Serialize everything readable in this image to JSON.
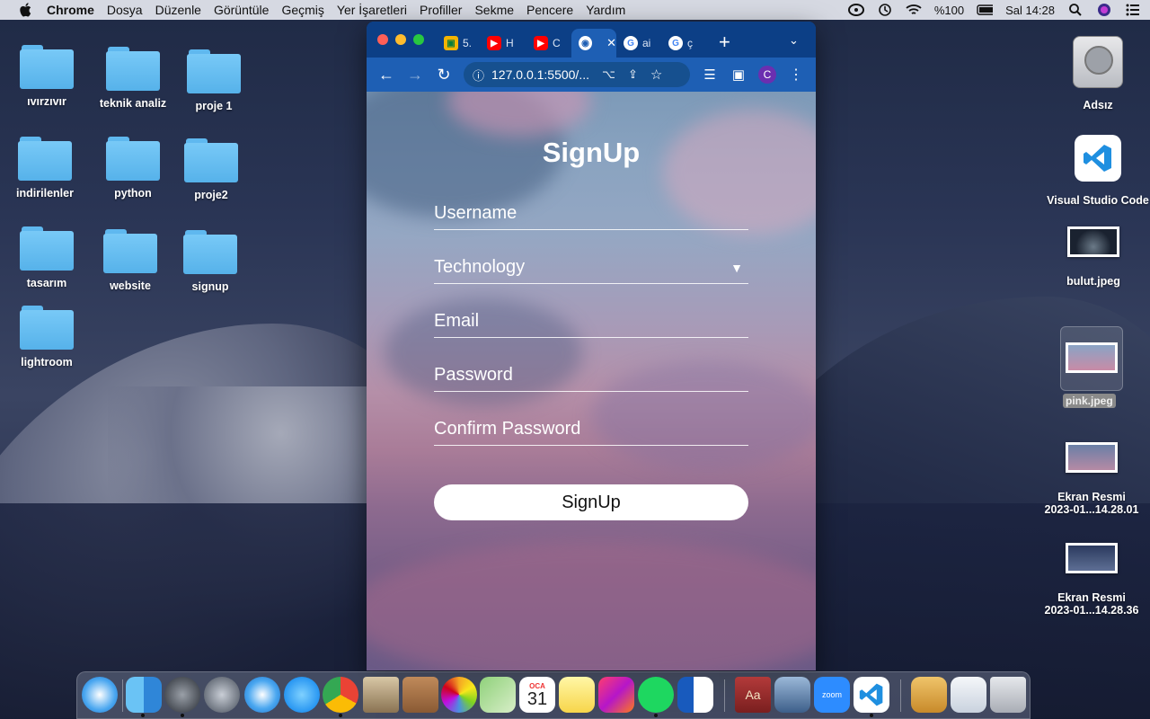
{
  "menubar": {
    "app": "Chrome",
    "items": [
      "Dosya",
      "Düzenle",
      "Görüntüle",
      "Geçmiş",
      "Yer İşaretleri",
      "Profiller",
      "Sekme",
      "Pencere",
      "Yardım"
    ],
    "battery": "%100",
    "clock": "Sal 14:28"
  },
  "desktop": {
    "folders": [
      "ıvırzıvır",
      "teknik analiz",
      "proje 1",
      "indirilenler",
      "python",
      "proje2",
      "tasarım",
      "website",
      "signup",
      "lightroom"
    ],
    "right_items": {
      "drive": "Adsız",
      "vscode": "Visual Studio Code",
      "bulut": "bulut.jpeg",
      "pink": "pink.jpeg",
      "shot1_line1": "Ekran Resmi",
      "shot1_line2": "2023-01...14.28.01",
      "shot2_line1": "Ekran Resmi",
      "shot2_line2": "2023-01...14.28.36"
    }
  },
  "browser": {
    "tabs": [
      "5.",
      "H",
      "C",
      "",
      "ai",
      "ç"
    ],
    "new_tab": "+",
    "url": "127.0.0.1:5500/...",
    "profile_initial": "C"
  },
  "page": {
    "title": "SignUp",
    "username_placeholder": "Username",
    "technology_label": "Technology",
    "email_placeholder": "Email",
    "password_placeholder": "Password",
    "confirm_placeholder": "Confirm Password",
    "button_label": "SignUp"
  },
  "dock": {
    "calendar_month": "OCA",
    "calendar_day": "31",
    "zoom_label": "zoom"
  },
  "colors": {
    "tab_bar": "#0c3f86",
    "toolbar": "#1e5fb4",
    "folder": "#6cc2f4"
  }
}
